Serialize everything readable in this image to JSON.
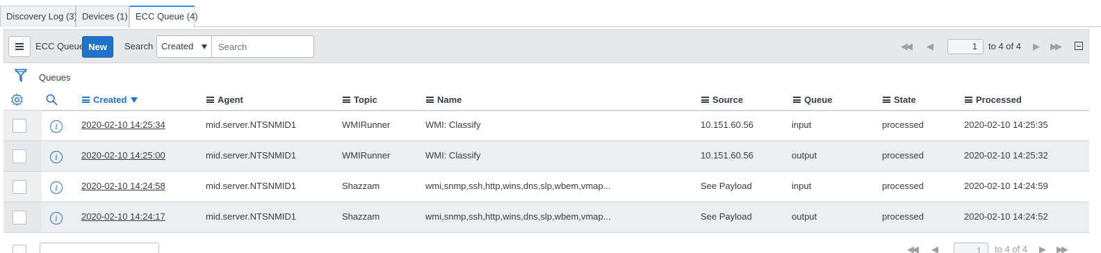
{
  "tabs": [
    {
      "label": "Discovery Log (3)"
    },
    {
      "label": "Devices (1)"
    },
    {
      "label": "ECC Queue (4)",
      "active": true
    }
  ],
  "toolbar": {
    "menu_icon": "hamburger-icon",
    "title": "ECC Queue",
    "new_label": "New",
    "search_label": "Search",
    "search_field_selected": "Created",
    "search_placeholder": "Search",
    "page_current": "1",
    "page_range": "to 4 of 4",
    "accent_color": "#1f73c8"
  },
  "breadcrumb": {
    "filter_icon": "funnel-icon",
    "label": "Queues"
  },
  "columns": [
    {
      "label": "Created",
      "sorted": "desc"
    },
    {
      "label": "Agent"
    },
    {
      "label": "Topic"
    },
    {
      "label": "Name"
    },
    {
      "label": "Source"
    },
    {
      "label": "Queue"
    },
    {
      "label": "State"
    },
    {
      "label": "Processed"
    }
  ],
  "rows": [
    {
      "created": "2020-02-10 14:25:34",
      "agent": "mid.server.NTSNMID1",
      "topic": "WMIRunner",
      "name": "WMI: Classify",
      "source": "10.151.60.56",
      "queue": "input",
      "state": "processed",
      "processed": "2020-02-10 14:25:35"
    },
    {
      "created": "2020-02-10 14:25:00",
      "agent": "mid.server.NTSNMID1",
      "topic": "WMIRunner",
      "name": "WMI: Classify",
      "source": "10.151.60.56",
      "queue": "output",
      "state": "processed",
      "processed": "2020-02-10 14:25:32"
    },
    {
      "created": "2020-02-10 14:24:58",
      "agent": "mid.server.NTSNMID1",
      "topic": "Shazzam",
      "name": "wmi,snmp,ssh,http,wins,dns,slp,wbem,vmap...",
      "source": "See Payload",
      "queue": "input",
      "state": "processed",
      "processed": "2020-02-10 14:24:59"
    },
    {
      "created": "2020-02-10 14:24:17",
      "agent": "mid.server.NTSNMID1",
      "topic": "Shazzam",
      "name": "wmi,snmp,ssh,http,wins,dns,slp,wbem,vmap...",
      "source": "See Payload",
      "queue": "output",
      "state": "processed",
      "processed": "2020-02-10 14:24:52"
    }
  ],
  "footer": {
    "page_current": "1",
    "page_range": "to 4 of 4"
  }
}
